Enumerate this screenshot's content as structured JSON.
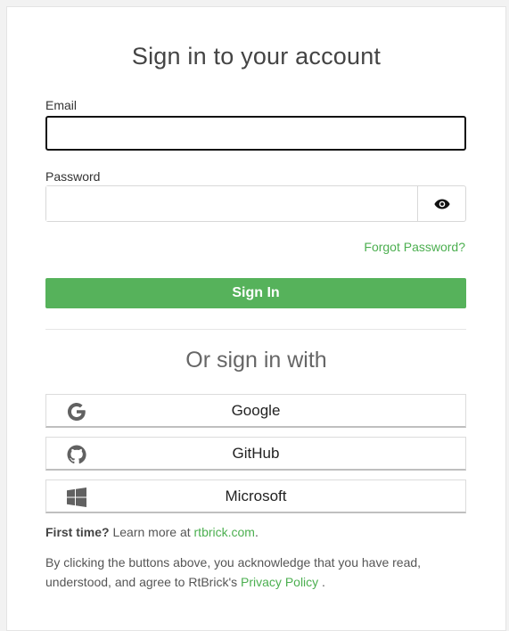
{
  "title": "Sign in to your account",
  "email": {
    "label": "Email",
    "value": "",
    "placeholder": ""
  },
  "password": {
    "label": "Password",
    "value": "",
    "placeholder": ""
  },
  "forgot_password": "Forgot Password?",
  "sign_in_button": "Sign In",
  "or_sign_in_with": "Or sign in with",
  "providers": [
    {
      "name": "Google",
      "icon": "google-icon"
    },
    {
      "name": "GitHub",
      "icon": "github-icon"
    },
    {
      "name": "Microsoft",
      "icon": "windows-icon"
    }
  ],
  "first_time": {
    "bold": "First time?",
    "text": " Learn more at ",
    "link": "rtbrick.com",
    "suffix": "."
  },
  "terms": {
    "text": "By clicking the buttons above, you acknowledge that you have read, understood, and agree to RtBrick's ",
    "link": "Privacy Policy",
    "suffix": " ."
  },
  "colors": {
    "accent": "#56b25b",
    "link": "#4caf50"
  }
}
